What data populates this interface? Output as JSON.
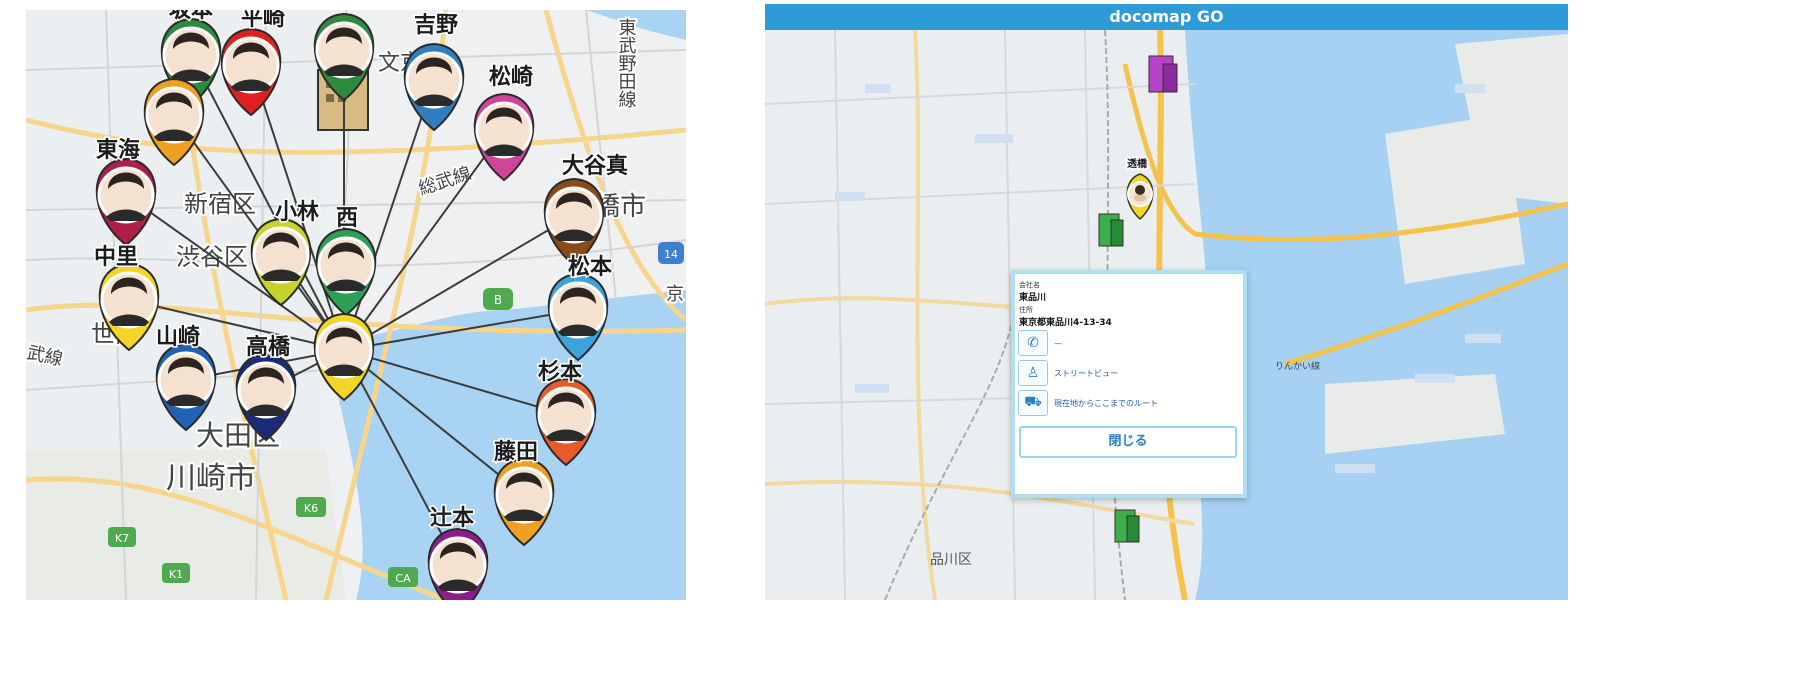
{
  "left_map": {
    "place_labels": {
      "shinjuku": "新宿区",
      "shibuya": "渋谷区",
      "ota": "大田区",
      "kawasaki": "川崎市",
      "bunkyo": "文京区",
      "sobu": "総武線",
      "tobu": "東武野田線",
      "ichikawa": "橋市",
      "setagaya": "世田",
      "sen": "武線",
      "road_b": "B",
      "road_k6": "K6",
      "road_k7": "K7",
      "road_k1": "K1",
      "road_ca": "CA",
      "road_14": "14",
      "road_kyo": "京"
    },
    "pins": [
      {
        "name": "坂本",
        "color": "#2e8b3e"
      },
      {
        "name": "平崎",
        "color": "#e02020"
      },
      {
        "name": "",
        "color": "#2e8b3e"
      },
      {
        "name": "吉野",
        "color": "#2f7fc0"
      },
      {
        "name": "松崎",
        "color": "#d1449b"
      },
      {
        "name": "",
        "color": "#f0a020"
      },
      {
        "name": "東海",
        "color": "#b01e4a"
      },
      {
        "name": "大谷真",
        "color": "#8b4a1a"
      },
      {
        "name": "小林",
        "color": "#c7d22e"
      },
      {
        "name": "西",
        "color": "#2ea055"
      },
      {
        "name": "中里",
        "color": "#f3d528"
      },
      {
        "name": "松本",
        "color": "#3ea3dc"
      },
      {
        "name": "山崎",
        "color": "#2262b5"
      },
      {
        "name": "高橋",
        "color": "#1c2a7a"
      },
      {
        "name": "",
        "color": "#f3d528"
      },
      {
        "name": "杉本",
        "color": "#e85a2a"
      },
      {
        "name": "藤田",
        "color": "#f0a020"
      },
      {
        "name": "辻本",
        "color": "#8a1e8a"
      }
    ]
  },
  "right_map": {
    "brand": "docomap GO",
    "popup": {
      "company_caption": "会社名",
      "company_name": "東品川",
      "address_caption": "住所",
      "address": "東京都東品川4-13-34",
      "phone": "—",
      "street_view": "ストリートビュー",
      "route": "現在地からここまでのルート",
      "close": "閉じる"
    },
    "labels": {
      "shinagawa": "品川区",
      "rinkai": "りんかい線",
      "pin_name": "透橋"
    },
    "icons": {
      "phone": "phone-icon",
      "street_view": "pegman-icon",
      "route": "car-icon"
    }
  }
}
